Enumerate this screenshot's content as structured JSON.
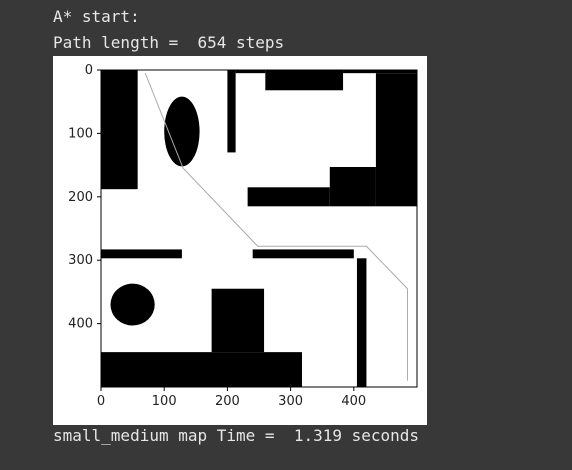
{
  "output": {
    "line1": "A* start:",
    "line2": "Path length =  654 steps",
    "line3": "small_medium map Time =  1.319 seconds"
  },
  "chart_data": {
    "type": "heatmap",
    "subtype": "binary occupancy grid with path overlay",
    "colormap": [
      "#000000",
      "#ffffff"
    ],
    "xlim": [
      0,
      500
    ],
    "ylim": [
      500,
      0
    ],
    "y_inverted": true,
    "xticks": [
      0,
      100,
      200,
      300,
      400
    ],
    "yticks": [
      0,
      100,
      200,
      300,
      400
    ],
    "obstacles": [
      {
        "shape": "rect",
        "x": [
          0,
          58
        ],
        "y": [
          0,
          188
        ]
      },
      {
        "shape": "ellipse",
        "cx": 128,
        "cy": 97,
        "rx": 28,
        "ry": 55
      },
      {
        "shape": "rect",
        "x": [
          200,
          213
        ],
        "y": [
          0,
          130
        ]
      },
      {
        "shape": "rect",
        "x": [
          213,
          260
        ],
        "y": [
          0,
          5
        ]
      },
      {
        "shape": "rect",
        "x": [
          260,
          383
        ],
        "y": [
          0,
          32
        ]
      },
      {
        "shape": "rect",
        "x": [
          383,
          500
        ],
        "y": [
          0,
          5
        ]
      },
      {
        "shape": "rect",
        "x": [
          435,
          500
        ],
        "y": [
          5,
          215
        ]
      },
      {
        "shape": "rect",
        "x": [
          362,
          435
        ],
        "y": [
          153,
          215
        ]
      },
      {
        "shape": "rect",
        "x": [
          232,
          362
        ],
        "y": [
          185,
          215
        ]
      },
      {
        "shape": "rect",
        "x": [
          0,
          128
        ],
        "y": [
          283,
          297
        ]
      },
      {
        "shape": "rect",
        "x": [
          240,
          400
        ],
        "y": [
          283,
          297
        ]
      },
      {
        "shape": "rect",
        "x": [
          405,
          420
        ],
        "y": [
          297,
          500
        ]
      },
      {
        "shape": "ellipse",
        "cx": 50,
        "cy": 370,
        "rx": 35,
        "ry": 33
      },
      {
        "shape": "rect",
        "x": [
          175,
          258
        ],
        "y": [
          345,
          445
        ]
      },
      {
        "shape": "rect",
        "x": [
          0,
          318
        ],
        "y": [
          445,
          500
        ]
      }
    ],
    "path": [
      [
        70,
        5
      ],
      [
        130,
        155
      ],
      [
        248,
        278
      ],
      [
        420,
        278
      ],
      [
        485,
        345
      ],
      [
        485,
        490
      ]
    ],
    "path_color": "#aaaaaa"
  }
}
